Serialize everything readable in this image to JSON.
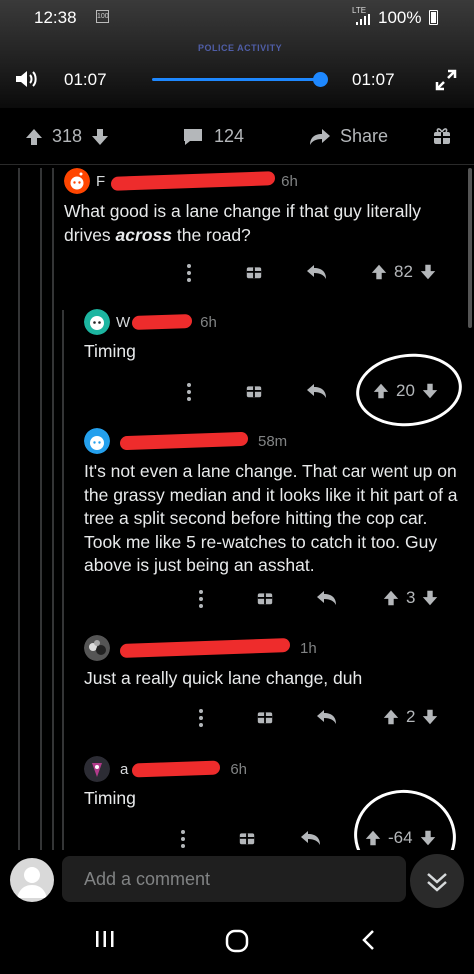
{
  "status": {
    "time": "12:38",
    "notif": "100",
    "network": "LTE",
    "battery": "100%"
  },
  "video": {
    "overlay_text": "POLICE ACTIVITY",
    "current_time": "01:07",
    "duration": "01:07",
    "progress": 1.0
  },
  "post": {
    "upvotes": "318",
    "comments": "124",
    "share_label": "Share"
  },
  "comments": [
    {
      "age": "6h",
      "text_pre": "What good is a lane change if that guy literally drives ",
      "text_em": "across",
      "text_post": " the road?",
      "score": "82",
      "initial": "F"
    },
    {
      "age": "6h",
      "text": "Timing",
      "score": "20",
      "initial": "W"
    },
    {
      "age": "58m",
      "text": "It's not even a lane change. That car went up on the grassy median and it looks like it hit part of a tree a split second before hitting the cop car. Took me like 5 re-watches to catch it too. Guy above is just being an asshat.",
      "score": "3",
      "initial": ""
    },
    {
      "age": "1h",
      "text": "Just a really quick lane change, duh",
      "score": "2",
      "initial": ""
    },
    {
      "age": "6h",
      "text": "Timing",
      "score": "-64",
      "initial": "a"
    }
  ],
  "composer": {
    "placeholder": "Add a comment"
  },
  "colors": {
    "redaction": "#ee2c2c",
    "accent": "#1e88ff",
    "background": "#000000"
  }
}
